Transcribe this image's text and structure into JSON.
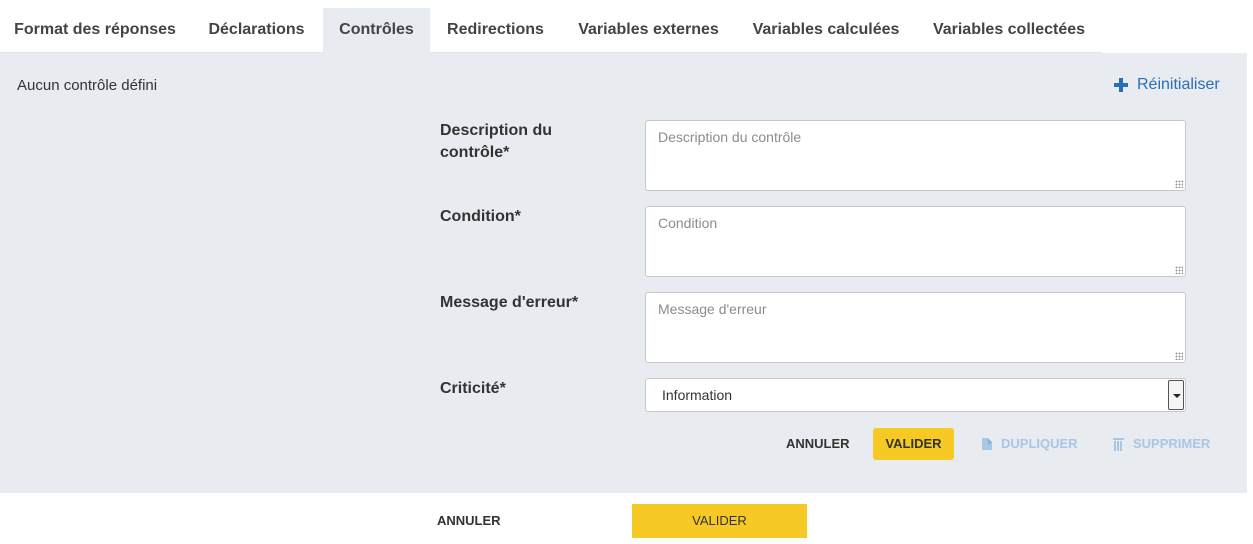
{
  "tabs": [
    {
      "label": "Format des réponses",
      "active": false
    },
    {
      "label": "Déclarations",
      "active": false
    },
    {
      "label": "Contrôles",
      "active": true
    },
    {
      "label": "Redirections",
      "active": false
    },
    {
      "label": "Variables externes",
      "active": false
    },
    {
      "label": "Variables calculées",
      "active": false
    },
    {
      "label": "Variables collectées",
      "active": false
    }
  ],
  "panel": {
    "empty_text": "Aucun contrôle défini",
    "reset_label": "Réinitialiser",
    "fields": {
      "description": {
        "label": "Description du contrôle*",
        "placeholder": "Description du contrôle",
        "value": ""
      },
      "condition": {
        "label": "Condition*",
        "placeholder": "Condition",
        "value": ""
      },
      "message": {
        "label": "Message d'erreur*",
        "placeholder": "Message d'erreur",
        "value": ""
      },
      "criticite": {
        "label": "Criticité*",
        "selected": "Information"
      }
    },
    "actions": {
      "annuler": "ANNULER",
      "valider": "VALIDER",
      "dupliquer": "DUPLIQUER",
      "supprimer": "SUPPRIMER"
    }
  },
  "footer": {
    "annuler": "ANNULER",
    "valider": "VALIDER"
  },
  "colors": {
    "accent_yellow": "#f6c924",
    "link_blue": "#2a6eb5",
    "disabled_blue": "#a8c6e6",
    "panel_bg": "#e8ebef"
  },
  "icons": {
    "reset": "plus-icon",
    "dupliquer": "file-icon",
    "supprimer": "trash-icon"
  }
}
